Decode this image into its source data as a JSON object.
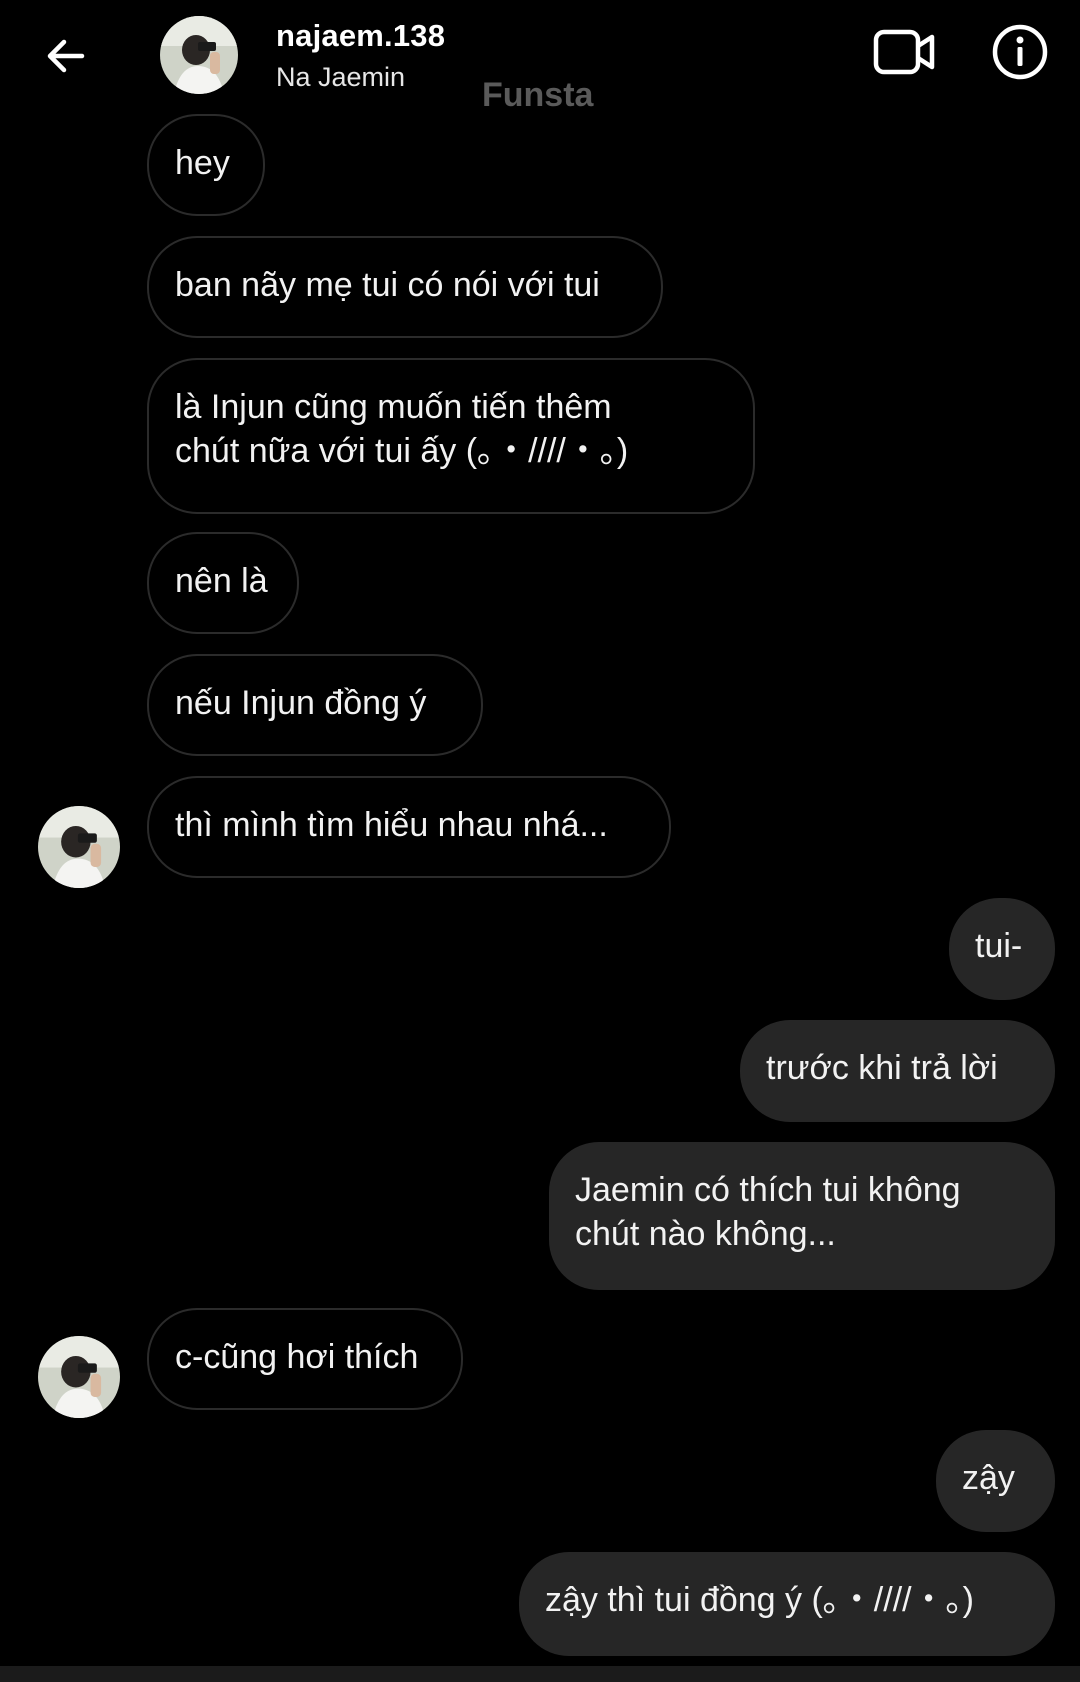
{
  "header": {
    "username": "najaem.138",
    "display_name": "Na Jaemin",
    "back_icon": "arrow-left-icon",
    "video_icon": "video-camera-icon",
    "info_icon": "info-circle-icon"
  },
  "watermark": "Funsta",
  "messages": [
    {
      "from": "them",
      "text": "hey"
    },
    {
      "from": "them",
      "text": "ban nãy mẹ tui có nói với tui"
    },
    {
      "from": "them",
      "text": "là Injun cũng muốn tiến thêm\nchút nữa với tui ấy (｡・////・｡)"
    },
    {
      "from": "them",
      "text": "nên là"
    },
    {
      "from": "them",
      "text": "nếu Injun đồng ý"
    },
    {
      "from": "them",
      "text": "thì mình tìm hiểu nhau nhá..."
    },
    {
      "from": "me",
      "text": "tui-"
    },
    {
      "from": "me",
      "text": "trước khi trả lời"
    },
    {
      "from": "me",
      "text": "Jaemin có thích tui không\nchút nào không..."
    },
    {
      "from": "them",
      "text": "c-cũng hơi thích"
    },
    {
      "from": "me",
      "text": "zậy"
    },
    {
      "from": "me",
      "text": "zậy thì tui đồng ý (｡・////・｡)"
    }
  ],
  "colors": {
    "background": "#000000",
    "outgoing_bubble": "#262626",
    "incoming_border": "#2b2b2b",
    "watermark": "#5a5a5a"
  }
}
